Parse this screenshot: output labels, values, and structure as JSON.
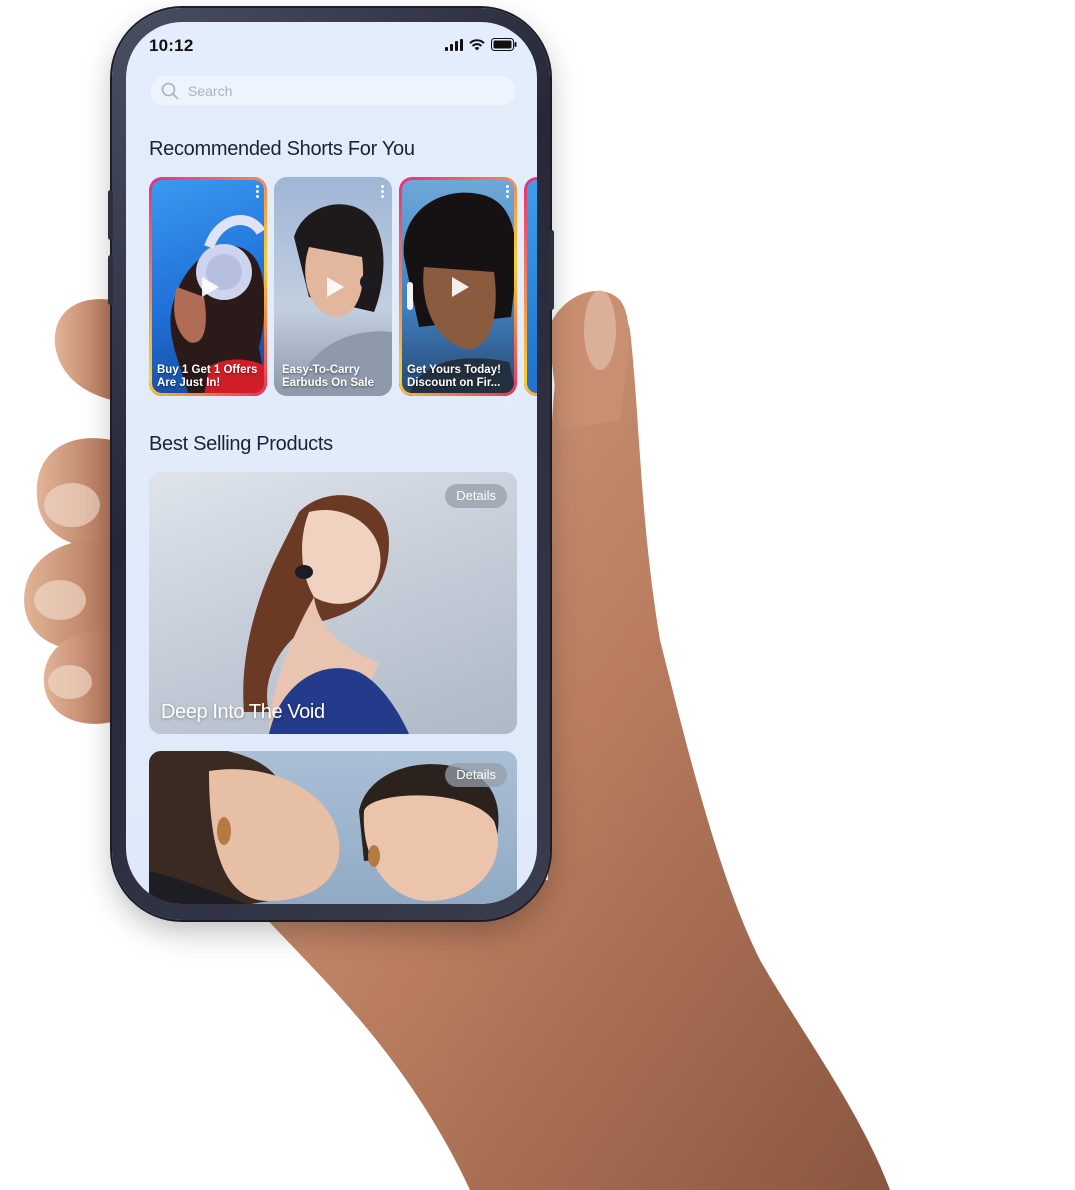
{
  "status_bar": {
    "time": "10:12"
  },
  "search": {
    "placeholder": "Search"
  },
  "sections": {
    "shorts_title": "Recommended Shorts For You",
    "best_selling_title": "Best Selling Products"
  },
  "shorts": [
    {
      "line1": "Buy 1 Get 1 Offers",
      "line2": "Are Just In!"
    },
    {
      "line1": "Easy-To-Carry",
      "line2": "Earbuds On Sale"
    },
    {
      "line1": "Get Yours Today!",
      "line2": "Discount on Fir..."
    }
  ],
  "products": [
    {
      "title": "Deep Into The Void",
      "details_label": "Details"
    },
    {
      "title": "",
      "details_label": "Details"
    }
  ],
  "colors": {
    "screen_bg": "#e3edfb",
    "story_ring": "#e6315a",
    "text_dark": "#1b2236"
  },
  "icons": [
    "search-icon",
    "signal-icon",
    "wifi-icon",
    "battery-icon",
    "play-icon",
    "more-vertical-icon"
  ]
}
